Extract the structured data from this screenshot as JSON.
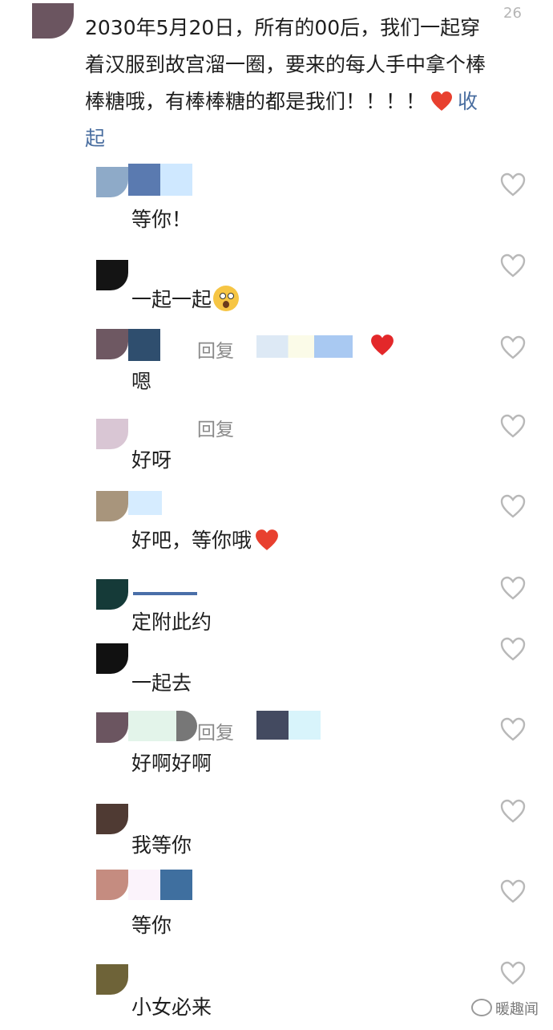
{
  "main_comment": {
    "text": "2030年5月20日，所有的00后，我们一起穿着汉服到故宫溜一圈，要来的每人手中拿个棒棒糖哦，有棒棒糖的都是我们！！！！",
    "collapse_label": "收起",
    "like_count": "26"
  },
  "replies": [
    {
      "text": "等你！",
      "reply_label": ""
    },
    {
      "text": "一起一起",
      "reply_label": ""
    },
    {
      "text": "嗯",
      "reply_label": "回复"
    },
    {
      "text": "好呀",
      "reply_label": "回复"
    },
    {
      "text": "好吧，等你哦",
      "reply_label": ""
    },
    {
      "text": "定附此约",
      "reply_label": ""
    },
    {
      "text": "一起去",
      "reply_label": ""
    },
    {
      "text": "好啊好啊",
      "reply_label": "回复"
    },
    {
      "text": "我等你",
      "reply_label": ""
    },
    {
      "text": "等你",
      "reply_label": ""
    },
    {
      "text": "小女必来",
      "reply_label": ""
    }
  ],
  "icons": {
    "like": "heart-outline-icon",
    "heart": "red-heart-icon",
    "emoji": "shocked-face-icon"
  },
  "colors": {
    "collapse_link": "#4a6ea0",
    "heart_red": "#e8402f",
    "muted": "#8a8a8a"
  },
  "watermark": {
    "text": "暖趣闻"
  }
}
